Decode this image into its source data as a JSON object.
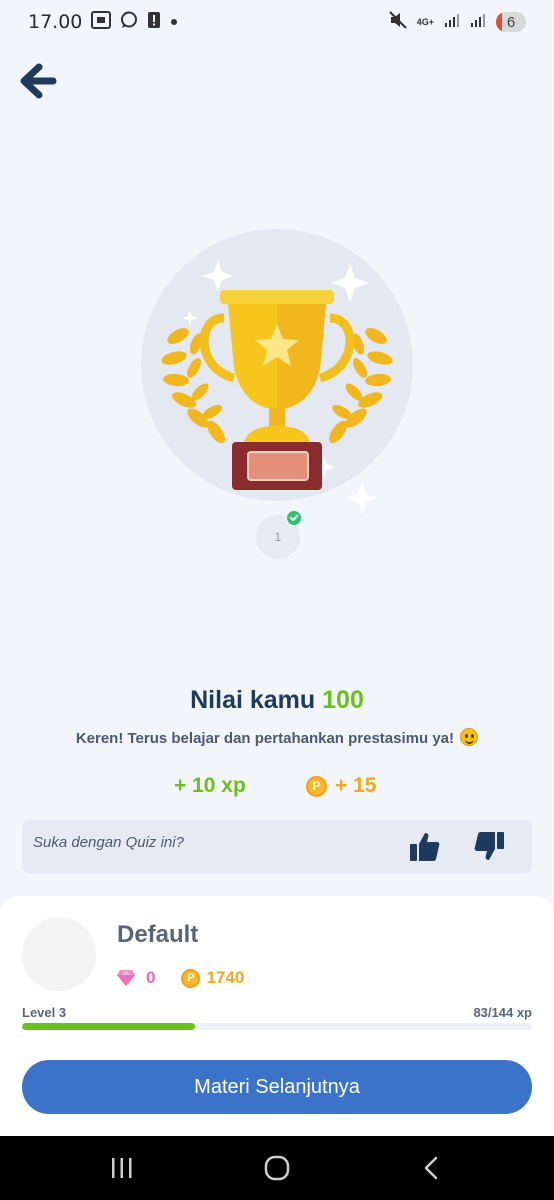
{
  "status_bar": {
    "time": "17.00",
    "network": "4G+",
    "battery": "6"
  },
  "header": {
    "back_icon": "arrow-left-icon"
  },
  "result": {
    "step_number": "1",
    "title_prefix": "Nilai kamu",
    "score": "100",
    "message": "Keren! Terus belajar dan pertahankan prestasimu ya!",
    "xp_reward": "+ 10 xp",
    "coin_reward": "+ 15"
  },
  "feedback": {
    "question": "Suka dengan Quiz ini?"
  },
  "profile": {
    "name": "Default",
    "gems": "0",
    "coins": "1740",
    "level": "Level 3",
    "xp": "83/144 xp",
    "xp_progress": 0.34
  },
  "actions": {
    "next_label": "Materi Selanjutnya"
  },
  "colors": {
    "accent": "#3b73c8",
    "green": "#6cc01c",
    "navy": "#1e3a5f",
    "coin": "#f0a81c",
    "gem": "#ee6fb5"
  }
}
